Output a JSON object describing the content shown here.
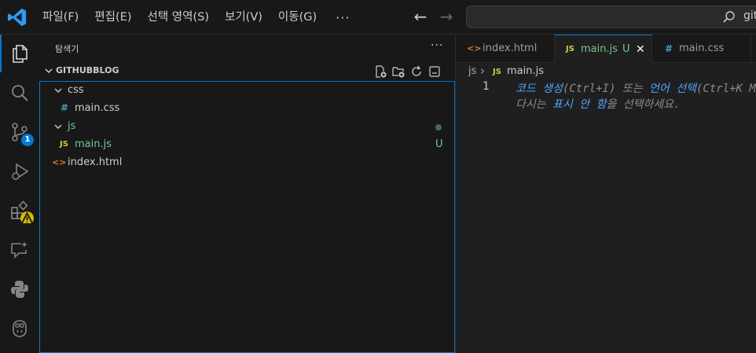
{
  "menu": {
    "items": [
      "파일(F)",
      "편집(E)",
      "선택 영역(S)",
      "보기(V)",
      "이동(G)"
    ],
    "more": "···"
  },
  "command_center": {
    "text": "git"
  },
  "activity_bar": {
    "scm_badge": "1"
  },
  "sidebar": {
    "title": "탐색기",
    "more": "···",
    "section_title": "GITHUBBLOG",
    "tree": [
      {
        "label": "css",
        "type": "folder"
      },
      {
        "label": "main.css",
        "type": "css",
        "icon": "#"
      },
      {
        "label": "js",
        "type": "folder"
      },
      {
        "label": "main.js",
        "type": "js",
        "icon": "JS",
        "status": "U"
      },
      {
        "label": "index.html",
        "type": "html",
        "icon": "<>"
      }
    ]
  },
  "tabs": [
    {
      "label": "index.html",
      "icon": "<>"
    },
    {
      "label": "main.js",
      "icon": "JS",
      "status": "U",
      "close": "✕"
    },
    {
      "label": "main.css",
      "icon": "#"
    }
  ],
  "breadcrumb": {
    "folder": "js",
    "sep": "›",
    "icon": "JS",
    "file": "main.js"
  },
  "editor": {
    "line_number": "1",
    "hint_line1": [
      {
        "text": "코드 생성",
        "kw": true
      },
      {
        "text": "(Ctrl+I) 또는 ",
        "kw": false
      },
      {
        "text": "언어 선택",
        "kw": true
      },
      {
        "text": "(Ctrl+K M)",
        "kw": false
      }
    ],
    "hint_line2": [
      {
        "text": "다시는 ",
        "kw": false
      },
      {
        "text": "표시 안 함",
        "kw": true
      },
      {
        "text": "을 선택하세요.",
        "kw": false
      }
    ]
  },
  "colors": {
    "accent": "#0078d4",
    "js_icon": "#cbcb41",
    "css_icon": "#519aba",
    "html_icon": "#e37933",
    "untracked": "#73c991"
  }
}
